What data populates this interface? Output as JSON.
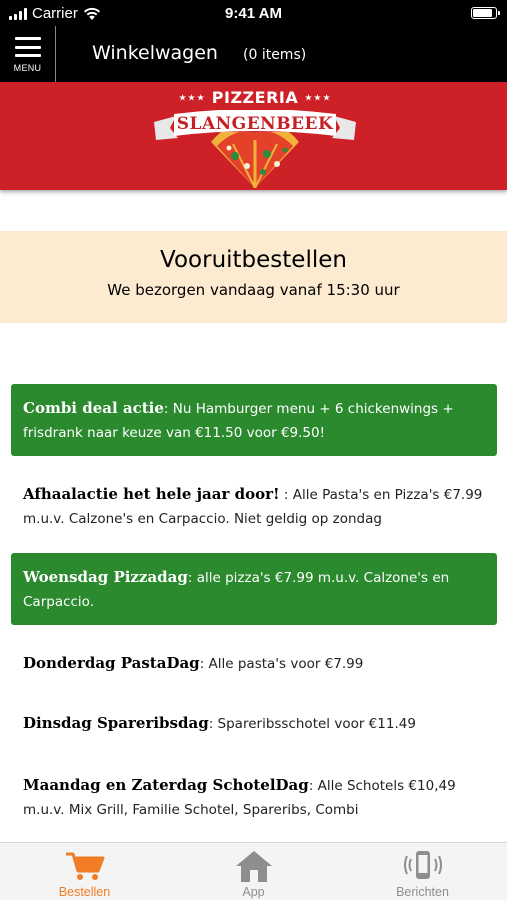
{
  "status_bar": {
    "carrier": "Carrier",
    "time": "9:41 AM"
  },
  "navbar": {
    "menu_label": "MENU",
    "title": "Winkelwagen",
    "count": "(0 items)"
  },
  "logo": {
    "top_text": "PIZZERIA",
    "name": "SLANGENBEEK"
  },
  "info": {
    "title": "Vooruitbestellen",
    "subtitle": "We bezorgen vandaag vanaf 15:30 uur"
  },
  "deals": [
    {
      "title": "Combi deal actie",
      "text": ": Nu Hamburger menu + 6 chickenwings + frisdrank naar keuze van €11.50 voor €9.50!",
      "highlight": true
    },
    {
      "title": "Afhaalactie het hele jaar door!",
      "text": " : Alle Pasta's en Pizza's €7.99 m.u.v. Calzone's en Carpaccio. Niet geldig op zondag",
      "highlight": false
    },
    {
      "title": "Woensdag Pizzadag",
      "text": ": alle pizza's €7.99 m.u.v. Calzone's en Carpaccio.",
      "highlight": true
    },
    {
      "title": "Donderdag PastaDag",
      "text": ": Alle pasta's voor €7.99",
      "highlight": false
    },
    {
      "title": "Dinsdag Spareribsdag",
      "text": ": Spareribsschotel voor €11.49",
      "highlight": false
    },
    {
      "title": "Maandag en Zaterdag SchotelDag",
      "text": ": Alle Schotels €10,49 m.u.v. Mix Grill, Familie Schotel, Spareribs, Combi",
      "highlight": false
    }
  ],
  "tabs": [
    {
      "label": "Bestellen",
      "icon": "cart-icon",
      "active": true
    },
    {
      "label": "App",
      "icon": "home-icon",
      "active": false
    },
    {
      "label": "Berichten",
      "icon": "phone-vibrate-icon",
      "active": false
    }
  ],
  "colors": {
    "accent": "#f07d26",
    "banner_red": "#cd2027",
    "deal_green": "#2b8a2e",
    "info_bg": "#fdebd1",
    "inactive_tab": "#8e8e8e"
  }
}
